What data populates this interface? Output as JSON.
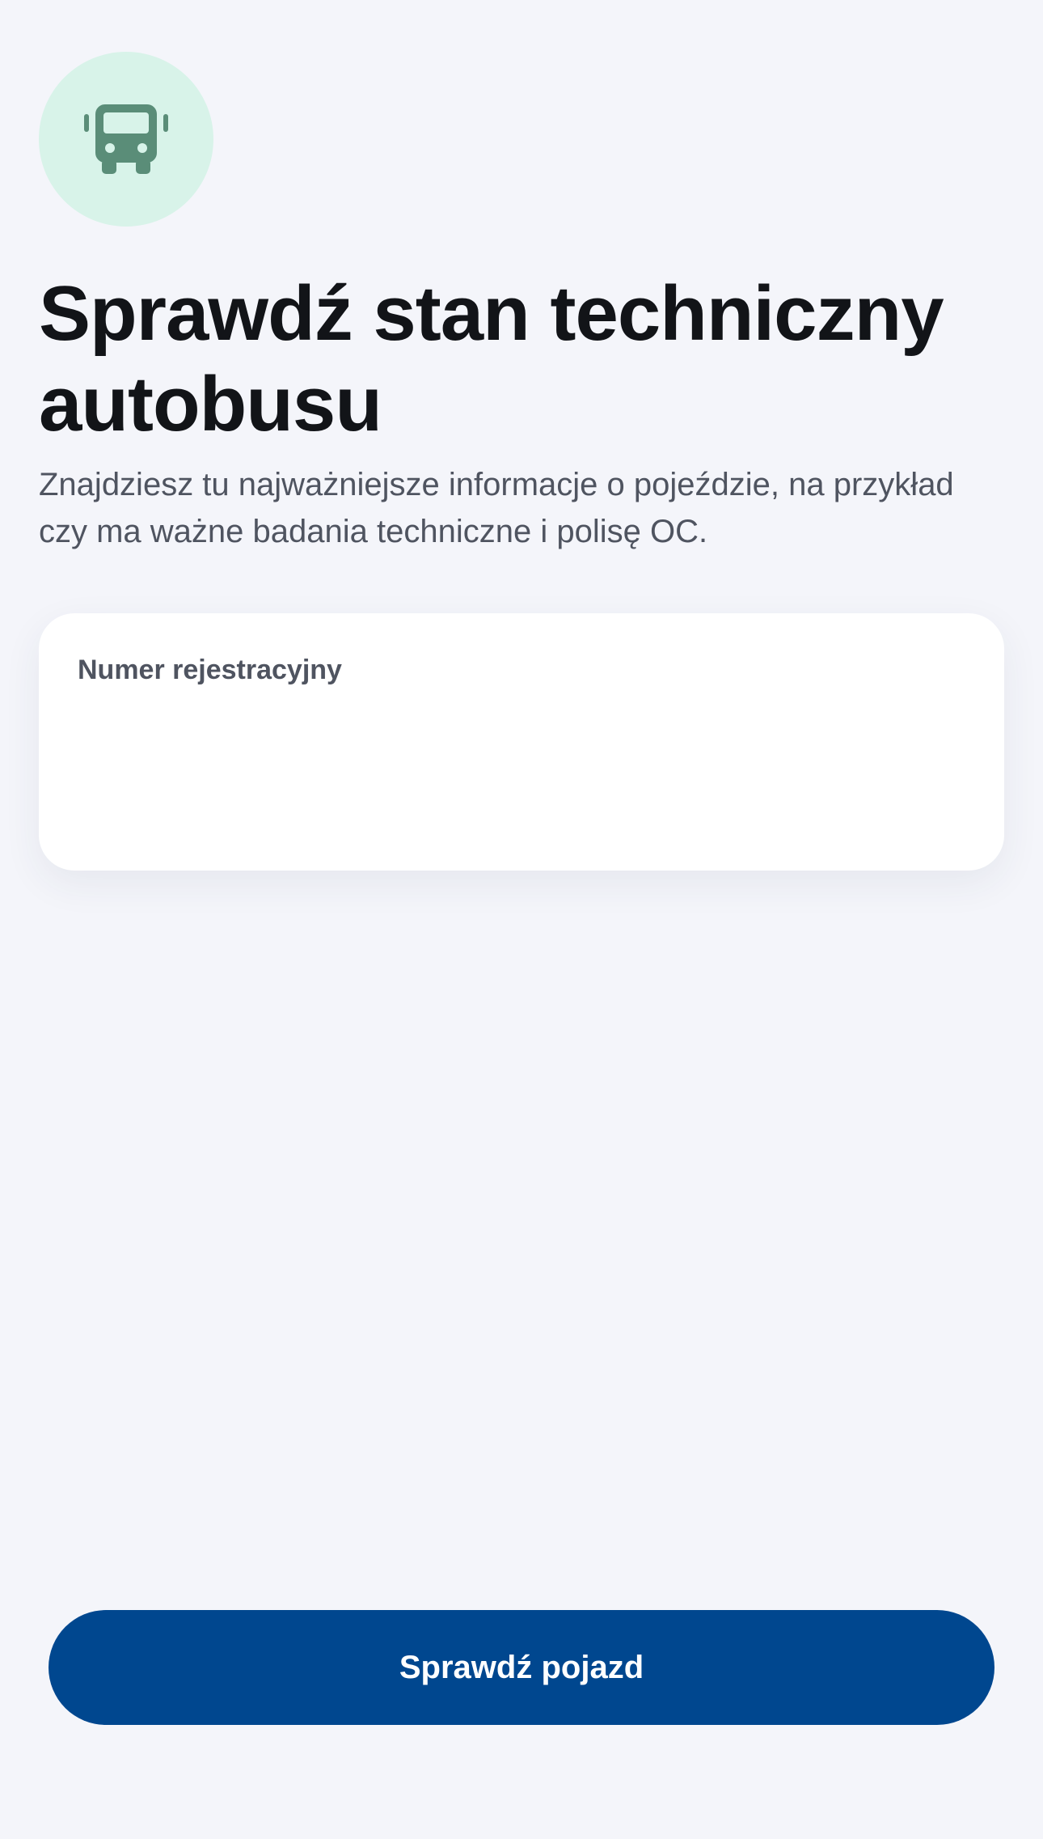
{
  "header": {
    "icon": "bus-icon",
    "title": "Sprawdź stan techniczny autobusu",
    "subtitle": "Znajdziesz tu najważniejsze informacje o pojeździe, na przykład czy ma ważne badania techniczne i polisę OC."
  },
  "form": {
    "registration_label": "Numer rejestracyjny",
    "registration_value": ""
  },
  "actions": {
    "check_label": "Sprawdź pojazd"
  },
  "colors": {
    "background": "#f4f5fa",
    "icon_circle": "#d8f3e9",
    "icon_color": "#5a8d78",
    "primary": "#00478f",
    "title_text": "#121418",
    "body_text": "#4f5460"
  }
}
